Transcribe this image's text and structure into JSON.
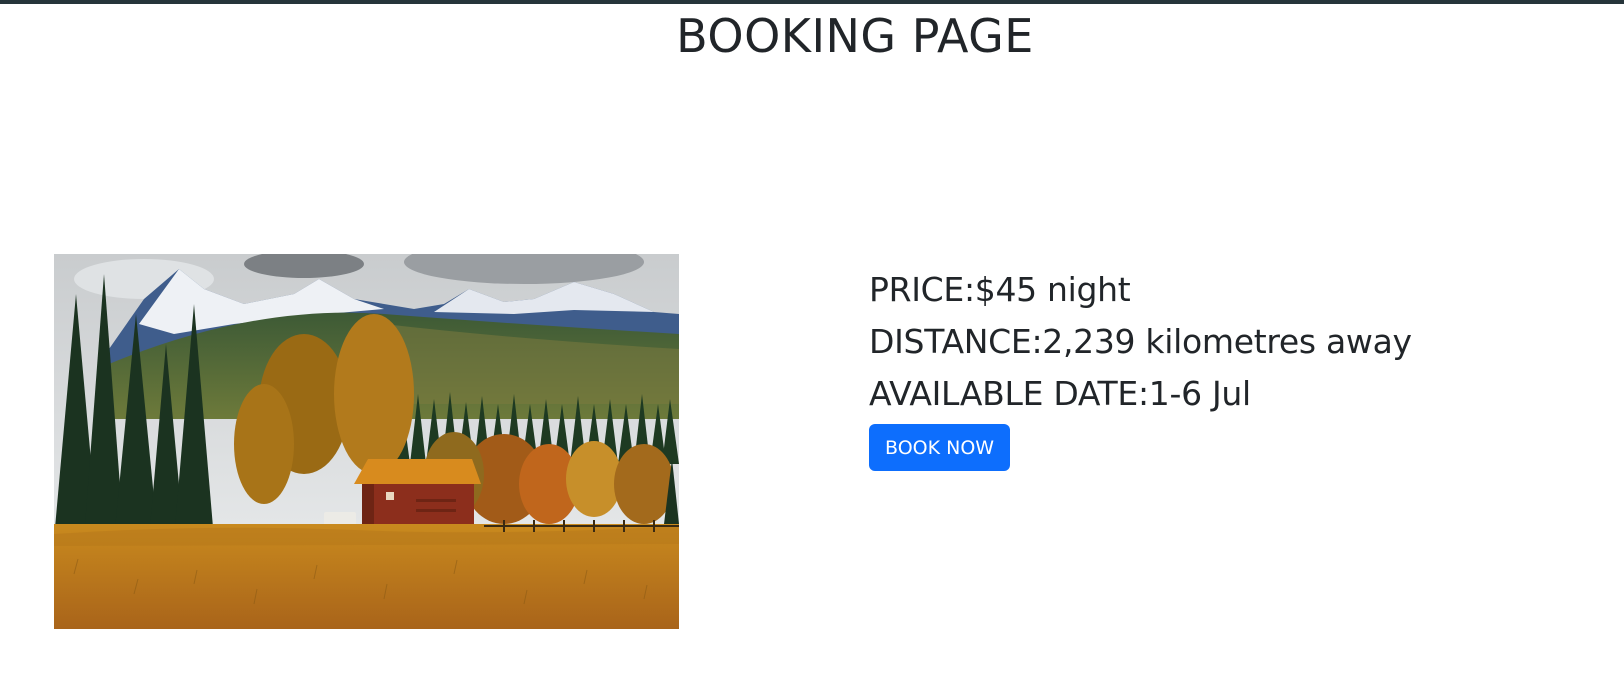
{
  "page": {
    "title": "BOOKING PAGE"
  },
  "listing": {
    "image_alt": "Cabin in autumn meadow with mountains",
    "price": "PRICE:$45 night",
    "distance": "DISTANCE:2,239 kilometres away",
    "available": "AVAILABLE DATE:1-6 Jul",
    "book_label": "BOOK NOW"
  },
  "colors": {
    "accent": "#0d6efd",
    "text": "#212529",
    "topbar": "#26353a"
  }
}
